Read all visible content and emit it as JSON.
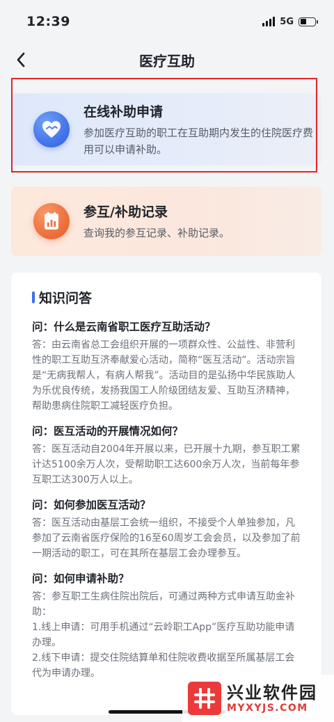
{
  "status_bar": {
    "time": "12:39",
    "network": "5G"
  },
  "header": {
    "title": "医疗互助"
  },
  "cards": [
    {
      "title": "在线补助申请",
      "desc": "参加医疗互助的职工在互助期内发生的住院医疗费用可以申请补助。",
      "icon": "handshake-heart-icon"
    },
    {
      "title": "参互/补助记录",
      "desc": "查询我的参互记录、补助记录。",
      "icon": "records-document-icon"
    }
  ],
  "knowledge": {
    "title": "知识问答",
    "qa": [
      {
        "q": "问：什么是云南省职工医疗互助活动？",
        "a": "答：由云南省总工会组织开展的一项群众性、公益性、非营利性的职工互助互济奉献爱心活动，简称“医互活动”。活动宗旨是“无病我帮人，有病人帮我”。活动目的是弘扬中华民族助人为乐优良传统，发扬我国工人阶级团结友爱、互助互济精神，帮助患病住院职工减轻医疗负担。"
      },
      {
        "q": "问：医互活动的开展情况如何？",
        "a": "答：医互活动自2004年开展以来，已开展十九期，参互职工累计达5100余万人次，受帮助职工达600余万人次，当前每年参互职工达300万人以上。"
      },
      {
        "q": "问：如何参加医互活动？",
        "a": "答：医互活动由基层工会统一组织，不接受个人单独参加，凡参加了云南省医疗保险的16至60周岁工会会员，以及参加了前一期活动的职工，可在其所在基层工会办理参互。"
      },
      {
        "q": "问：如何申请补助？",
        "a": "答：参互职工生病住院出院后，可通过两种方式申请互助金补助：",
        "a2": "1.线上申请：可用手机通过“云岭职工App”医疗互助功能申请办理。",
        "a3": "2.线下申请：提交住院结算单和住院收费收据至所属基层工会代为申请办理。"
      }
    ]
  },
  "watermark": {
    "name": "兴业软件园",
    "url": "MYXYJS.COM"
  },
  "colors": {
    "accent_blue": "#3f6ee8",
    "accent_orange": "#ec6a37",
    "highlight_red": "#e02424"
  }
}
